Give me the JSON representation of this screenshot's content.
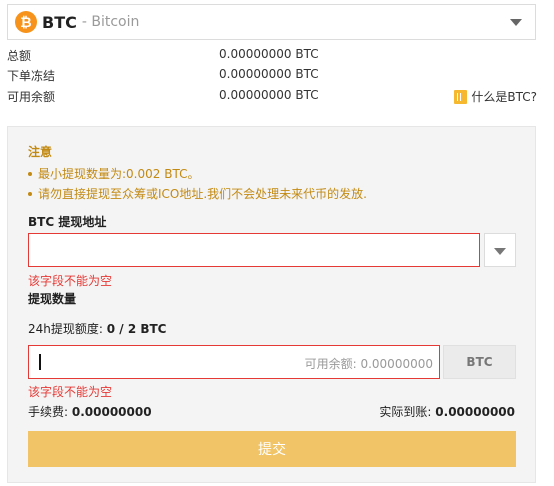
{
  "coin": {
    "symbol": "BTC",
    "separator": "-",
    "name": "Bitcoin",
    "icon_glyph": "₿",
    "icon": "bitcoin-icon",
    "color": "#f7931a"
  },
  "balances": {
    "total": {
      "label": "总额",
      "value": "0.00000000 BTC"
    },
    "frozen": {
      "label": "下单冻结",
      "value": "0.00000000 BTC"
    },
    "available": {
      "label": "可用余额",
      "value": "0.00000000 BTC"
    }
  },
  "what_is": {
    "label": "什么是BTC?",
    "icon": "book-icon"
  },
  "notice": {
    "title": "注意",
    "items": [
      "最小提现数量为:0.002 BTC。",
      "请勿直接提现至众筹或ICO地址.我们不会处理未来代币的发放."
    ],
    "color": "#c28a13"
  },
  "address": {
    "label": "BTC 提现地址",
    "value": "",
    "error": "该字段不能为空"
  },
  "amount": {
    "label": "提现数量",
    "limit_label": "24h提现额度: ",
    "limit_value": "0 / 2 BTC",
    "value": "",
    "placeholder": "可用余额: 0.00000000",
    "unit": "BTC",
    "error": "该字段不能为空"
  },
  "fee": {
    "label": "手续费: ",
    "value": "0.00000000"
  },
  "received": {
    "label": "实际到账: ",
    "value": "0.00000000"
  },
  "submit": {
    "label": "提交",
    "color": "#f0c467"
  },
  "colors": {
    "error": "#e53935",
    "accent": "#f7931a"
  }
}
